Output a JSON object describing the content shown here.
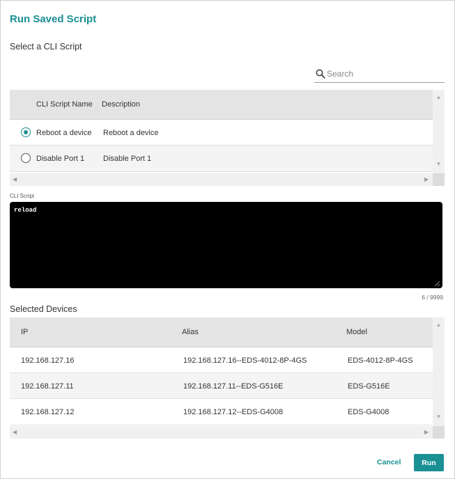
{
  "dialog": {
    "title": "Run Saved Script",
    "subtitle": "Select a CLI Script"
  },
  "search": {
    "placeholder": "Search",
    "value": ""
  },
  "scripts_table": {
    "columns": [
      "CLI Script Name",
      "Description"
    ],
    "rows": [
      {
        "name": "Reboot a device",
        "description": "Reboot a device",
        "selected": true
      },
      {
        "name": "Disable Port 1",
        "description": "Disable Port 1",
        "selected": false
      }
    ]
  },
  "cli_script": {
    "label": "CLI Script",
    "value": "reload",
    "counter": "6 / 9999"
  },
  "devices": {
    "title": "Selected Devices",
    "columns": [
      "IP",
      "Alias",
      "Model"
    ],
    "rows": [
      {
        "ip": "192.168.127.16",
        "alias": "192.168.127.16--EDS-4012-8P-4GS",
        "model": "EDS-4012-8P-4GS"
      },
      {
        "ip": "192.168.127.11",
        "alias": "192.168.127.11--EDS-G516E",
        "model": "EDS-G516E"
      },
      {
        "ip": "192.168.127.12",
        "alias": "192.168.127.12--EDS-G4008",
        "model": "EDS-G4008"
      }
    ]
  },
  "actions": {
    "cancel": "Cancel",
    "run": "Run"
  },
  "colors": {
    "accent": "#1a8f94",
    "header_bg": "#e4e4e4",
    "editor_bg": "#000000"
  },
  "icons": [
    "search-icon",
    "scroll-up-icon",
    "scroll-down-icon",
    "scroll-left-icon",
    "scroll-right-icon",
    "resize-handle-icon"
  ]
}
